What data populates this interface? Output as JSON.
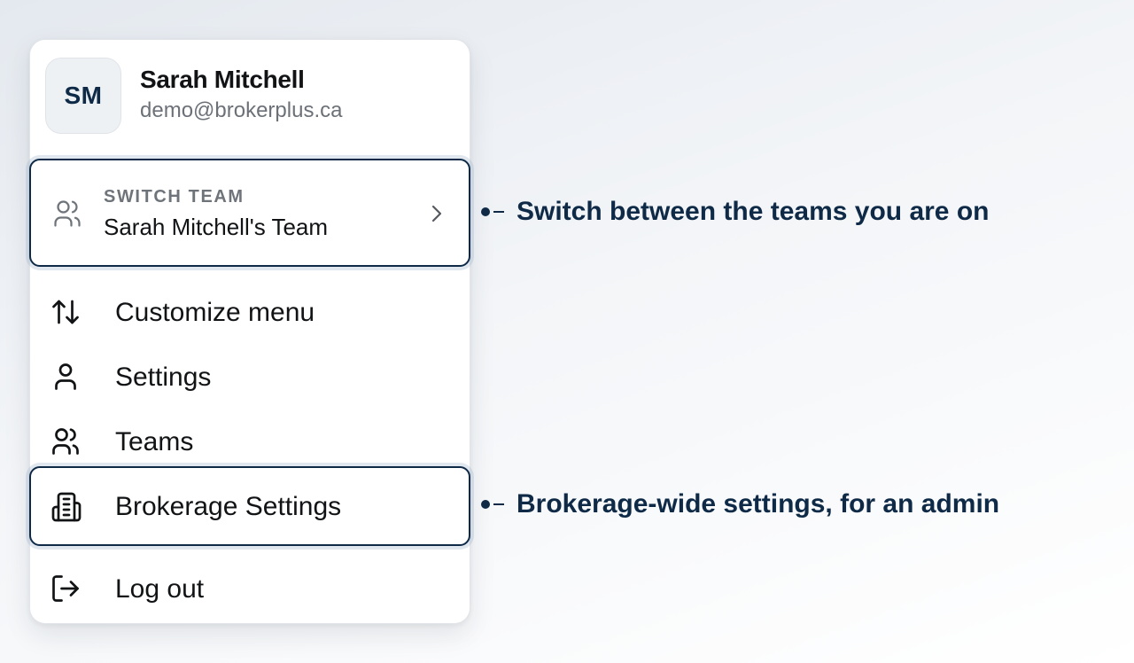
{
  "profile": {
    "initials": "SM",
    "name": "Sarah Mitchell",
    "email": "demo@brokerplus.ca"
  },
  "switch_team": {
    "label": "SWITCH TEAM",
    "value": "Sarah Mitchell's Team",
    "icon": "users-icon",
    "trailing_icon": "chevron-right-icon"
  },
  "menu": {
    "items": [
      {
        "label": "Customize menu",
        "icon": "arrows-up-down-icon"
      },
      {
        "label": "Settings",
        "icon": "user-icon"
      },
      {
        "label": "Teams",
        "icon": "users-icon"
      },
      {
        "label": "Brokerage Settings",
        "icon": "building-icon",
        "highlighted": true
      },
      {
        "label": "Log out",
        "icon": "log-out-icon"
      }
    ]
  },
  "callouts": [
    {
      "text": "Switch between the teams you are on"
    },
    {
      "text": "Brokerage-wide settings, for an admin"
    }
  ],
  "colors": {
    "accent": "#0e2a47",
    "text": "#111315",
    "muted": "#6c7178"
  }
}
